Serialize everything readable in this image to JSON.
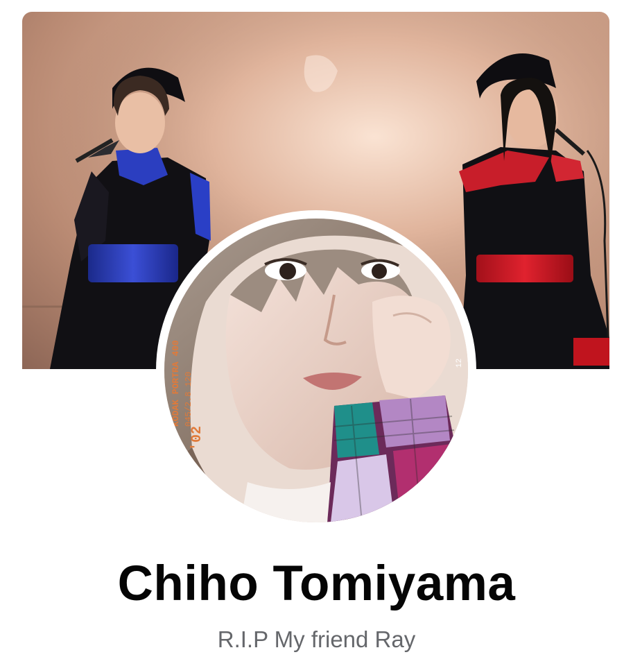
{
  "profile": {
    "name": "Chiho Tomiyama",
    "bio": "R.I.P My friend Ray"
  },
  "cover_photo": {
    "icon": "cover-photo"
  },
  "avatar": {
    "icon": "profile-picture",
    "film_text_1": "KODAK PORTRA 400",
    "film_text_2": "045/2.8 120",
    "film_text_3": "'02",
    "film_text_4": "12"
  },
  "colors": {
    "name_text": "#050505",
    "bio_text": "#65676b",
    "background": "#ffffff"
  }
}
